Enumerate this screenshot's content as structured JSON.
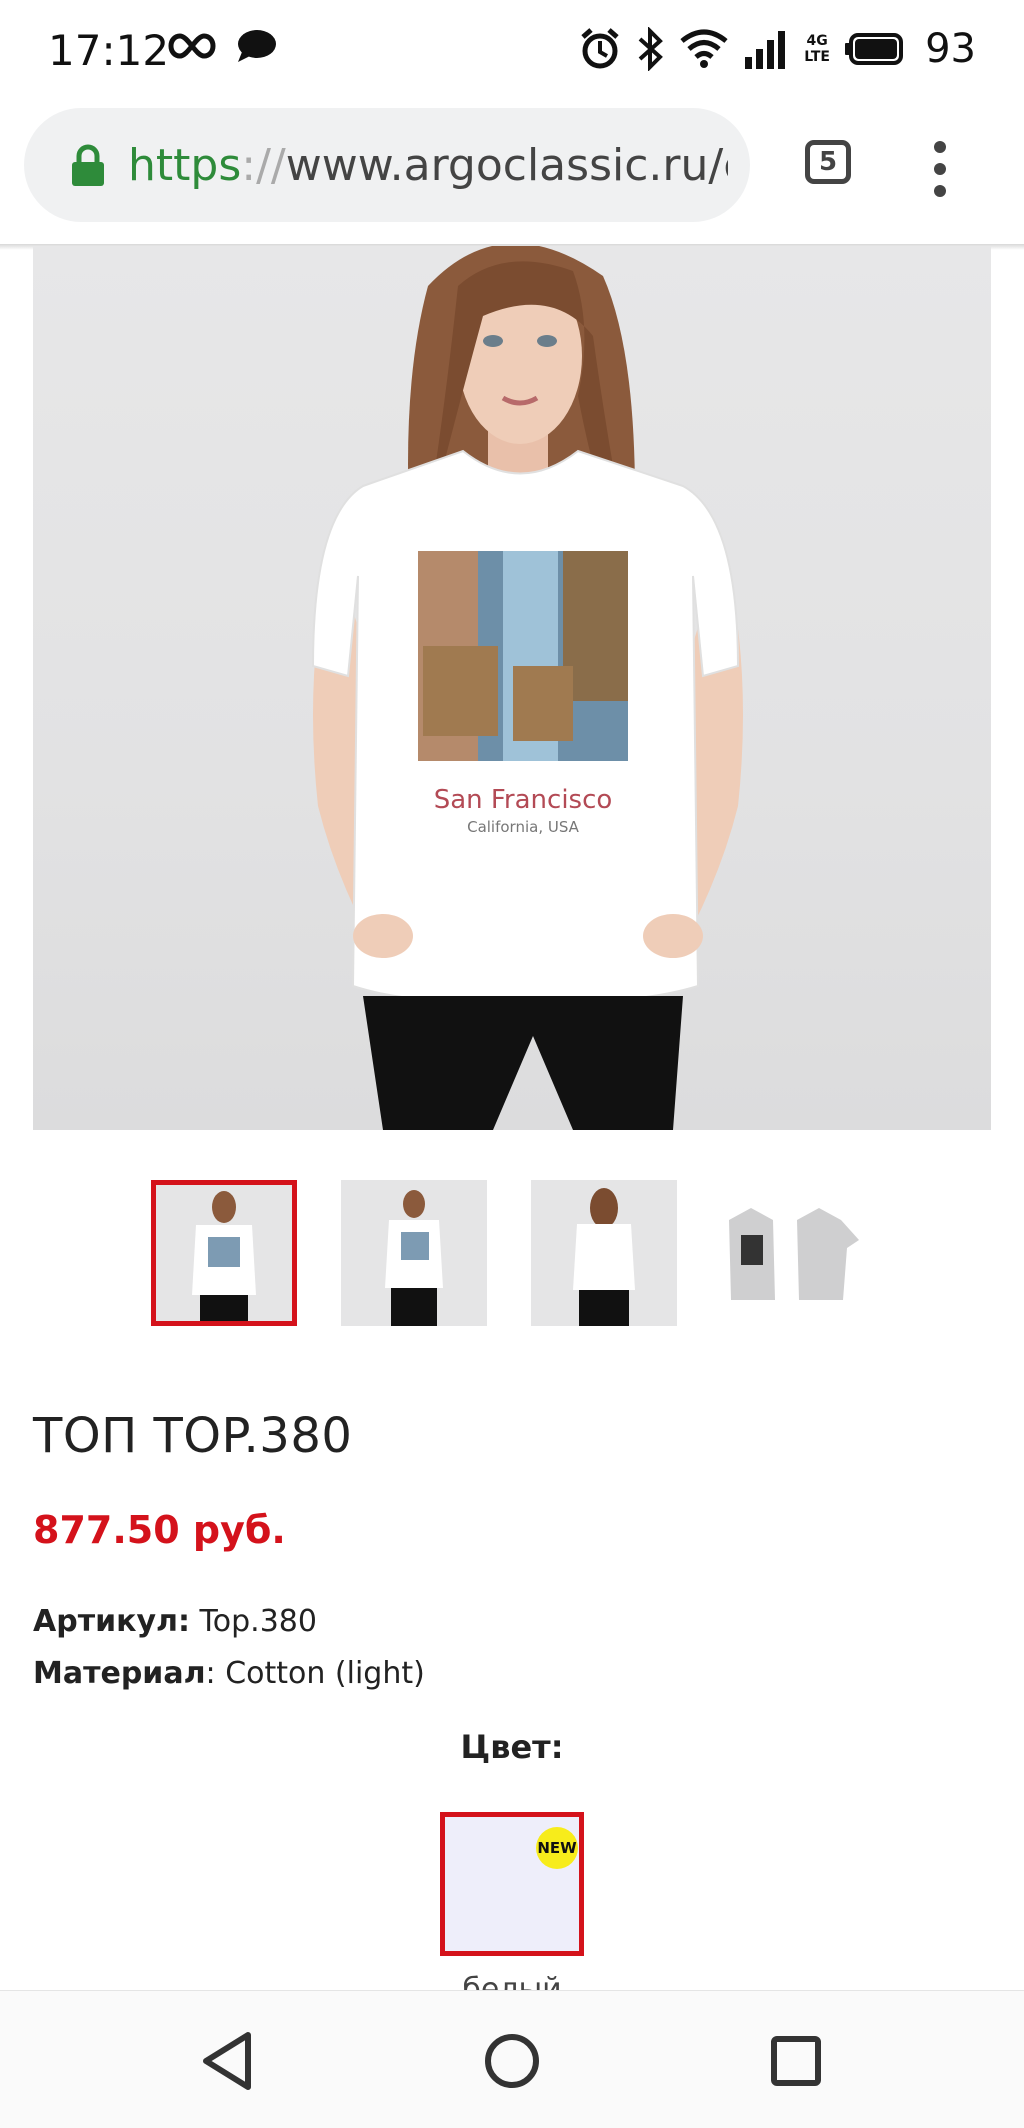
{
  "status_bar": {
    "time": "17:12",
    "network_label": "4G LTE",
    "battery_percent": "93"
  },
  "browser": {
    "url_scheme": "https",
    "url_slashes": "://",
    "url_rest": "www.argoclassic.ru/c",
    "tab_count": "5"
  },
  "product": {
    "image_print_title": "San Francisco",
    "image_print_subtitle": "California, USA",
    "title": "ТОП TOP.380",
    "price": "877.50 руб.",
    "sku_label": "Артикул:",
    "sku_value": " Top.380",
    "material_label": "Материал",
    "material_value": ": Cotton (light)",
    "color_heading": "Цвет:",
    "color_swatch_badge": "NEW",
    "color_swatch_label": "белый"
  },
  "colors": {
    "accent": "#d4121b",
    "url_scheme": "#2e8b3a",
    "badge": "#f7ec1b"
  }
}
